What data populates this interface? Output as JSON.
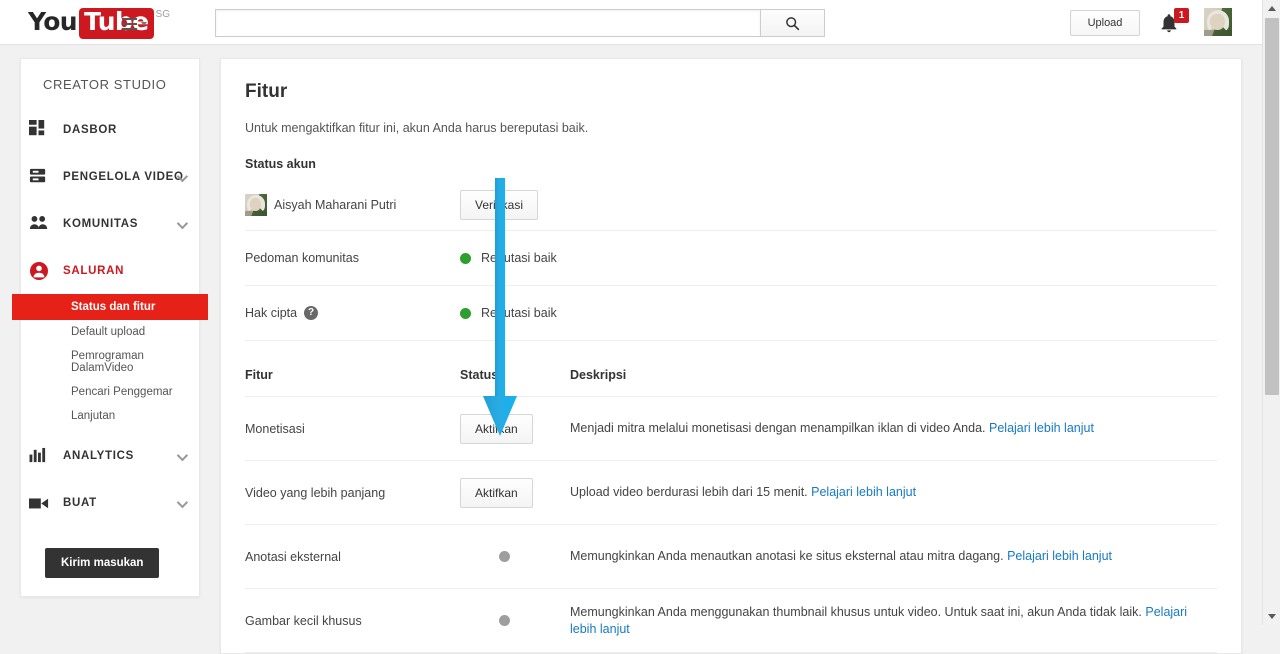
{
  "masthead": {
    "logo_you": "You",
    "logo_tube": "Tube",
    "logo_country": "SG",
    "guide_icon": "hamburger-menu-icon",
    "search": {
      "value": "",
      "placeholder": "",
      "icon": "search-icon"
    },
    "upload_label": "Upload",
    "notifications": {
      "icon": "bell-icon",
      "count": "1"
    },
    "avatar": "user-avatar"
  },
  "scrollbar": {
    "up_icon": "chevron-up-icon",
    "down_icon": "chevron-down-icon"
  },
  "sidebar": {
    "title": "CREATOR STUDIO",
    "feedback_label": "Kirim masukan",
    "groups": [
      {
        "label": "DASBOR",
        "icon": "dashboard-icon",
        "expandable": false,
        "active": false
      },
      {
        "label": "PENGELOLA VIDEO",
        "icon": "video-manager-icon",
        "expandable": true,
        "active": false
      },
      {
        "label": "KOMUNITAS",
        "icon": "community-people-icon",
        "expandable": true,
        "active": false
      },
      {
        "label": "SALURAN",
        "icon": "channel-person-icon",
        "expandable": false,
        "active": true
      },
      {
        "label": "ANALYTICS",
        "icon": "bar-chart-icon",
        "expandable": true,
        "active": false
      },
      {
        "label": "BUAT",
        "icon": "video-camera-icon",
        "expandable": true,
        "active": false
      }
    ],
    "channel_subitems": [
      {
        "label": "Status dan fitur",
        "selected": true
      },
      {
        "label": "Default upload",
        "selected": false
      },
      {
        "label": "Pemrograman DalamVideo",
        "selected": false
      },
      {
        "label": "Pencari Penggemar",
        "selected": false
      },
      {
        "label": "Lanjutan",
        "selected": false
      }
    ]
  },
  "main": {
    "title": "Fitur",
    "subtitle": "Untuk mengaktifkan fitur ini, akun Anda harus bereputasi baik.",
    "account_status_heading": "Status akun",
    "account": {
      "name": "Aisyah Maharani Putri",
      "verify_button": "Verifikasi"
    },
    "status_rows": [
      {
        "name": "Pedoman komunitas",
        "help": false,
        "dot": "green",
        "text": "Reputasi baik"
      },
      {
        "name": "Hak cipta",
        "help": true,
        "help_glyph": "?",
        "dot": "green",
        "text": "Reputasi baik"
      }
    ],
    "table_headers": {
      "feature": "Fitur",
      "status": "Status",
      "description": "Deskripsi"
    },
    "features": [
      {
        "name": "Monetisasi",
        "status_type": "button",
        "button_label": "Aktifkan",
        "description": "Menjadi mitra melalui monetisasi dengan menampilkan iklan di video Anda.",
        "link": "Pelajari lebih lanjut"
      },
      {
        "name": "Video yang lebih panjang",
        "status_type": "button",
        "button_label": "Aktifkan",
        "description": "Upload video berdurasi lebih dari 15 menit.",
        "link": "Pelajari lebih lanjut"
      },
      {
        "name": "Anotasi eksternal",
        "status_type": "dot",
        "dot": "grey",
        "description": "Memungkinkan Anda menautkan anotasi ke situs eksternal atau mitra dagang.",
        "link": "Pelajari lebih lanjut"
      },
      {
        "name": "Gambar kecil khusus",
        "status_type": "dot",
        "dot": "grey",
        "description": "Memungkinkan Anda menggunakan thumbnail khusus untuk video. Untuk saat ini, akun Anda tidak laik.",
        "link": "Pelajari lebih lanjut"
      }
    ]
  },
  "annotation": {
    "name": "blue-down-arrow-annotation",
    "color": "#29ABE2",
    "points_to": "Aktifkan"
  },
  "colors": {
    "brand_red": "#cc181e",
    "selected_red": "#e62117",
    "link_blue": "#167ac6",
    "status_green": "#2e9e2e",
    "status_grey": "#9e9e9e",
    "page_bg": "#f1f1f1"
  }
}
